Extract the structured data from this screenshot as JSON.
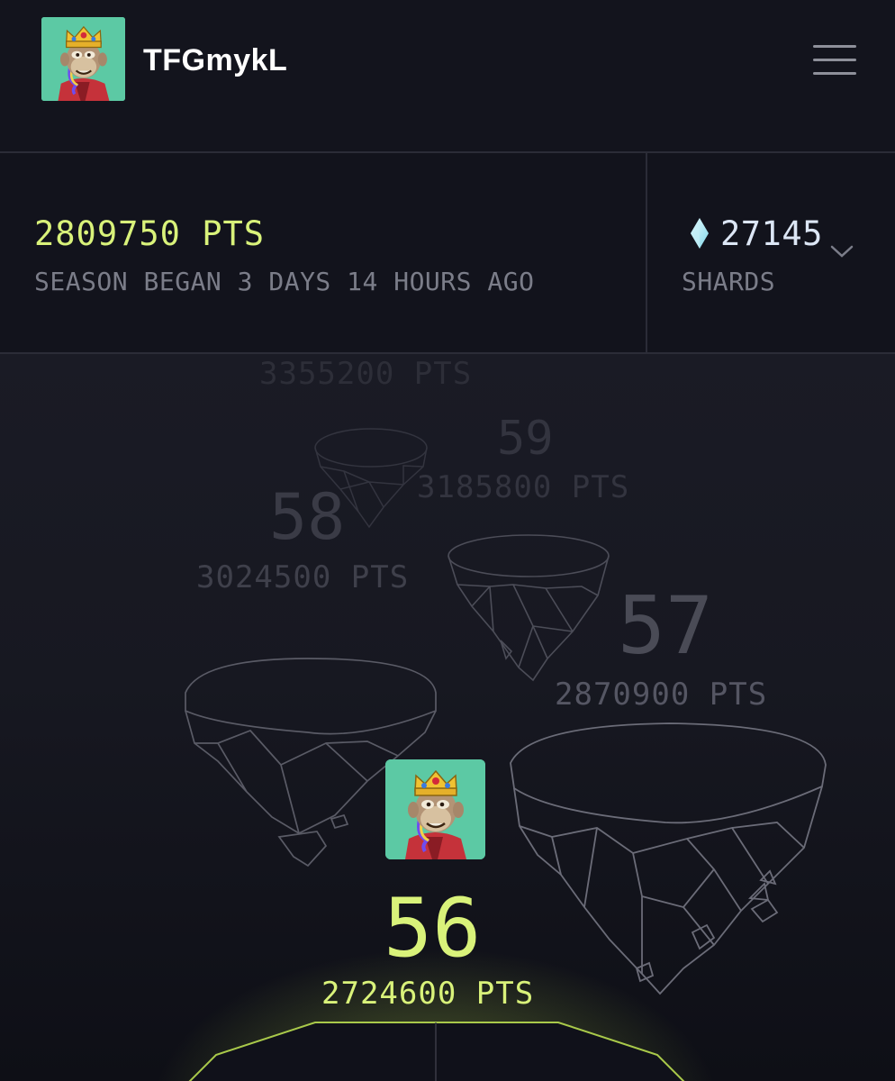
{
  "user": {
    "username": "TFGmykL",
    "avatar_icon": "bored-ape-king-avatar"
  },
  "menu": {
    "icon": "hamburger-menu-icon"
  },
  "stats": {
    "points_total": "2809750 PTS",
    "season_text": "SEASON BEGAN 3 DAYS 14 HOURS AGO",
    "shards_value": "27145",
    "shards_label": "SHARDS",
    "shard_icon": "crystal-shard-icon",
    "expand_icon": "chevron-down-icon"
  },
  "levels": [
    {
      "level": "",
      "points": "3355200 PTS"
    },
    {
      "level": "59",
      "points": "3185800 PTS"
    },
    {
      "level": "58",
      "points": "3024500 PTS"
    },
    {
      "level": "57",
      "points": "2870900 PTS"
    },
    {
      "level": "56",
      "points": "2724600 PTS",
      "current": true
    }
  ],
  "colors": {
    "accent": "#d9f27a",
    "background": "#12131c",
    "muted_text": "#7b7d89",
    "avatar_bg": "#5cc9a4"
  }
}
